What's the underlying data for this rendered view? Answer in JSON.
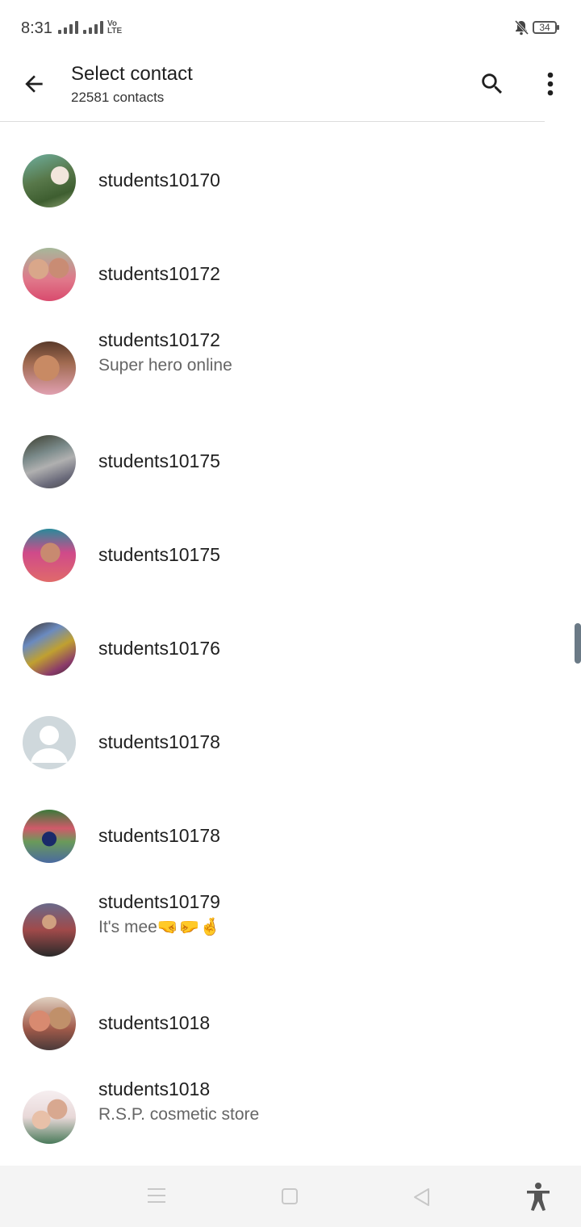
{
  "status_bar": {
    "time": "8:31",
    "volte_top": "Vo",
    "volte_bottom": "LTE",
    "battery": "34"
  },
  "app_bar": {
    "title": "Select contact",
    "subtitle": "22581 contacts"
  },
  "contacts": [
    {
      "name": "students10170",
      "status": ""
    },
    {
      "name": "students10172",
      "status": ""
    },
    {
      "name": "students10172",
      "status": "Super hero online"
    },
    {
      "name": "students10175",
      "status": ""
    },
    {
      "name": "students10175",
      "status": ""
    },
    {
      "name": "students10176",
      "status": ""
    },
    {
      "name": "students10178",
      "status": ""
    },
    {
      "name": "students10178",
      "status": ""
    },
    {
      "name": "students10179",
      "status": "It's mee🤜🤛🤞"
    },
    {
      "name": "students1018",
      "status": ""
    },
    {
      "name": "students1018",
      "status": "R.S.P. cosmetic store"
    }
  ],
  "icons": {
    "back": "arrow-left-icon",
    "search": "search-icon",
    "more": "more-vert-icon",
    "nav_menu": "menu-icon",
    "nav_home": "square-icon",
    "nav_back": "triangle-back-icon",
    "accessibility": "accessibility-icon"
  },
  "colors": {
    "background": "#ffffff",
    "text": "#1f1f1f",
    "secondary_text": "#666666",
    "default_avatar": "#cfd8dc"
  }
}
